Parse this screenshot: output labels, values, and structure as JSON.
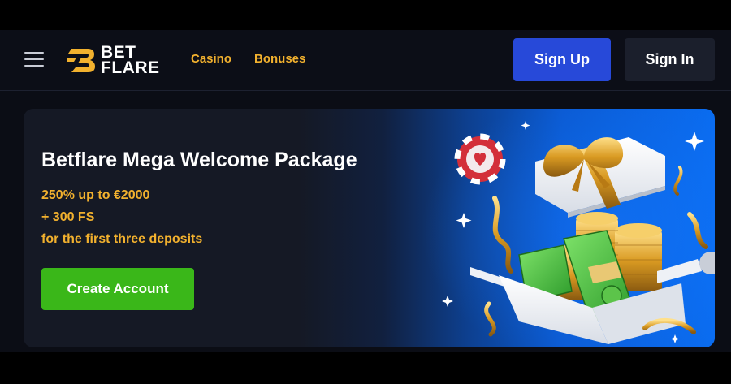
{
  "header": {
    "menu_icon": "hamburger-menu-icon",
    "logo": {
      "line1": "BET",
      "line2": "FLARE",
      "icon": "betflare-b-logo-icon",
      "accent": "#f2b12e"
    },
    "nav": [
      {
        "label": "Casino"
      },
      {
        "label": "Bonuses"
      }
    ],
    "signup_label": "Sign Up",
    "signin_label": "Sign In"
  },
  "promo": {
    "title": "Betflare Mega Welcome Package",
    "lines": [
      "250% up to €2000",
      "+ 300 FS",
      "for the first three deposits"
    ],
    "cta_label": "Create Account",
    "art": "gift-box-with-coins-and-cash-illustration"
  },
  "colors": {
    "brand_gold": "#f2b12e",
    "signup_blue": "#2749d9",
    "cta_green": "#3ab719",
    "header_bg": "#0c0e17"
  }
}
